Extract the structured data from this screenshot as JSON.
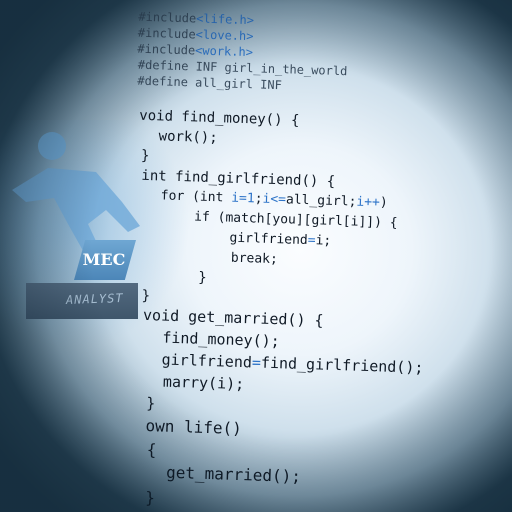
{
  "logo": {
    "text": "MEC",
    "subtitle": "ANALYST",
    "figure_icon": "running-figure-icon"
  },
  "colors": {
    "code_text": "#101a26",
    "code_highlight": "#2e74c8",
    "logo_blue": "#5a96c8",
    "plate_gray": "#4a6075",
    "background_edge": "#2d4a5c"
  },
  "code": {
    "l01": [
      "#include",
      "<life.h>"
    ],
    "l02": [
      "#include",
      "<love.h>"
    ],
    "l03": [
      "#include",
      "<work.h>"
    ],
    "l04": "#define INF girl_in_the_world",
    "l05": "#define all_girl INF",
    "l06": "void find_money() {",
    "l07": "work();",
    "l08": "}",
    "l09": "int find_girlfriend() {",
    "l10": [
      "for (int ",
      "i=1",
      ";",
      "i<=",
      "all_girl;",
      "i++",
      ")"
    ],
    "l11": "if (match[you][girl[i]]) {",
    "l12": [
      "girlfriend",
      "=",
      "i;"
    ],
    "l13": "break;",
    "l14": "}",
    "l15": "}",
    "l16": "void get_married() {",
    "l17": "find_money();",
    "l18": [
      "girlfriend",
      "=",
      "find_girlfriend();"
    ],
    "l19": "marry(i);",
    "l20": "}",
    "l21": "own life()",
    "l22": "{",
    "l23": "get_married();",
    "l24": "}"
  }
}
